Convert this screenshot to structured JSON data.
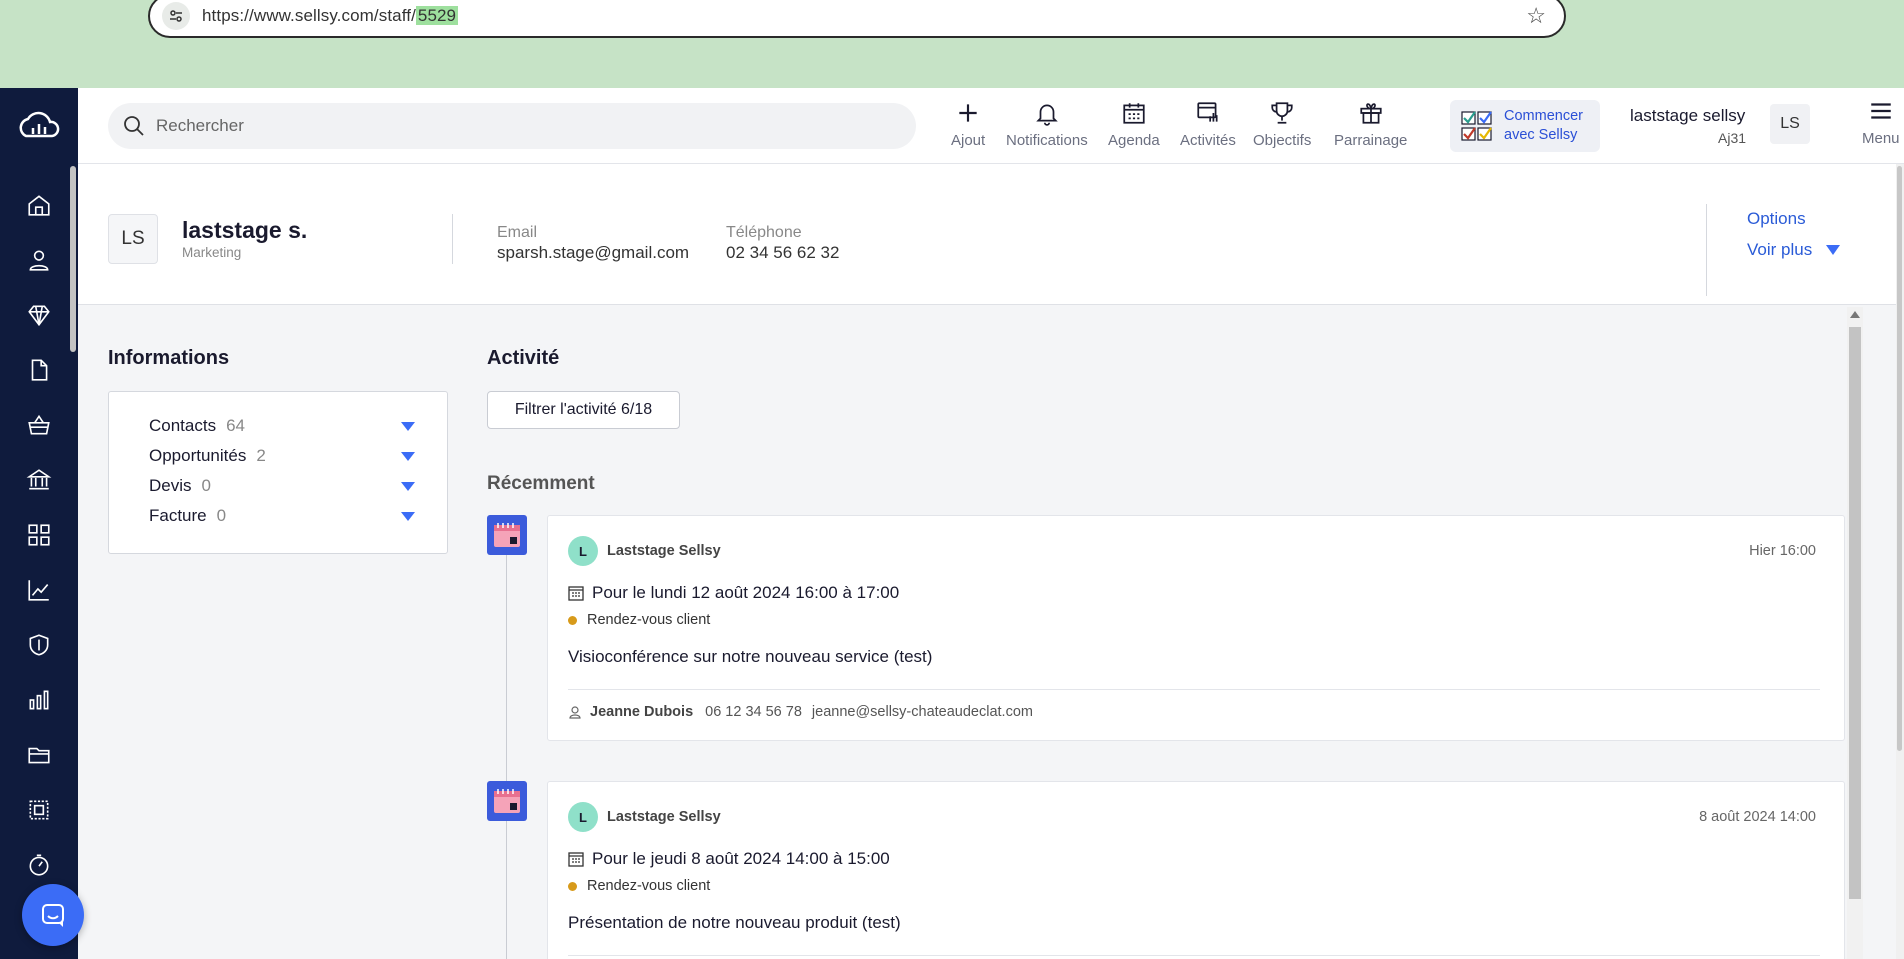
{
  "browser": {
    "url_prefix": "https://www.sellsy.com/staff/",
    "url_highlight": "5529"
  },
  "topbar": {
    "search_placeholder": "Rechercher",
    "items": [
      {
        "label": "Ajout",
        "icon": "plus-icon"
      },
      {
        "label": "Notifications",
        "icon": "bell-icon"
      },
      {
        "label": "Agenda",
        "icon": "calendar-icon"
      },
      {
        "label": "Activités",
        "icon": "activities-icon"
      },
      {
        "label": "Objectifs",
        "icon": "trophy-icon"
      },
      {
        "label": "Parrainage",
        "icon": "gift-icon"
      }
    ],
    "start_line1": "Commencer",
    "start_line2": "avec Sellsy",
    "user_name": "laststage sellsy",
    "user_code": "Aj31",
    "user_initials": "LS",
    "menu_label": "Menu"
  },
  "profile": {
    "initials": "LS",
    "name": "laststage s.",
    "role": "Marketing",
    "email_label": "Email",
    "email": "sparsh.stage@gmail.com",
    "phone_label": "Téléphone",
    "phone": "02 34 56 62 32",
    "options": "Options",
    "see_more": "Voir plus"
  },
  "informations": {
    "title": "Informations",
    "rows": [
      {
        "label": "Contacts",
        "count": "64"
      },
      {
        "label": "Opportunités",
        "count": "2"
      },
      {
        "label": "Devis",
        "count": "0"
      },
      {
        "label": "Facture",
        "count": "0"
      }
    ]
  },
  "activity": {
    "title": "Activité",
    "filter_label": "Filtrer l'activité 6/18",
    "recent_title": "Récemment",
    "cards": [
      {
        "avatar": "L",
        "author": "Laststage Sellsy",
        "time": "Hier 16:00",
        "when": "Pour le lundi 12 août 2024 16:00 à 17:00",
        "type": "Rendez-vous client",
        "description": "Visioconférence sur notre nouveau service (test)",
        "contact_name": "Jeanne Dubois",
        "contact_phone": "06 12 34 56 78",
        "contact_email": "jeanne@sellsy-chateaudeclat.com"
      },
      {
        "avatar": "L",
        "author": "Laststage Sellsy",
        "time": "8 août 2024 14:00",
        "when": "Pour le jeudi 8 août 2024 14:00 à 15:00",
        "type": "Rendez-vous client",
        "description": "Présentation de notre nouveau produit (test)"
      }
    ]
  },
  "colors": {
    "nav_bg": "#0f1b3d",
    "accent": "#3b6cf6",
    "link": "#2a5bd7",
    "browser_bg": "#c6e3c6"
  }
}
